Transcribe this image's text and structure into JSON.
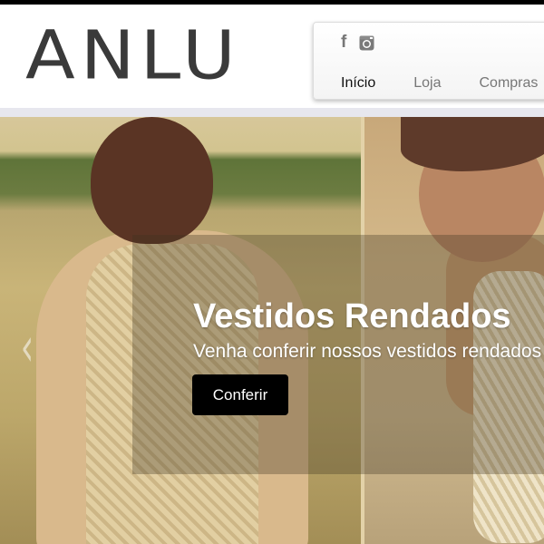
{
  "brand": {
    "logo_text": "ANLU"
  },
  "social": {
    "facebook_icon": "facebook-icon",
    "instagram_icon": "instagram-icon"
  },
  "nav": {
    "items": [
      {
        "label": "Início",
        "active": true
      },
      {
        "label": "Loja",
        "active": false
      },
      {
        "label": "Compras",
        "active": false
      }
    ]
  },
  "slide": {
    "title": "Vestidos Rendados",
    "subtitle": "Venha conferir nossos vestidos rendados",
    "button_label": "Conferir",
    "prev_arrow": "‹"
  },
  "colors": {
    "accent": "#000000",
    "nav_text": "#777777",
    "nav_active": "#111111",
    "overlay": "#3c321e"
  }
}
